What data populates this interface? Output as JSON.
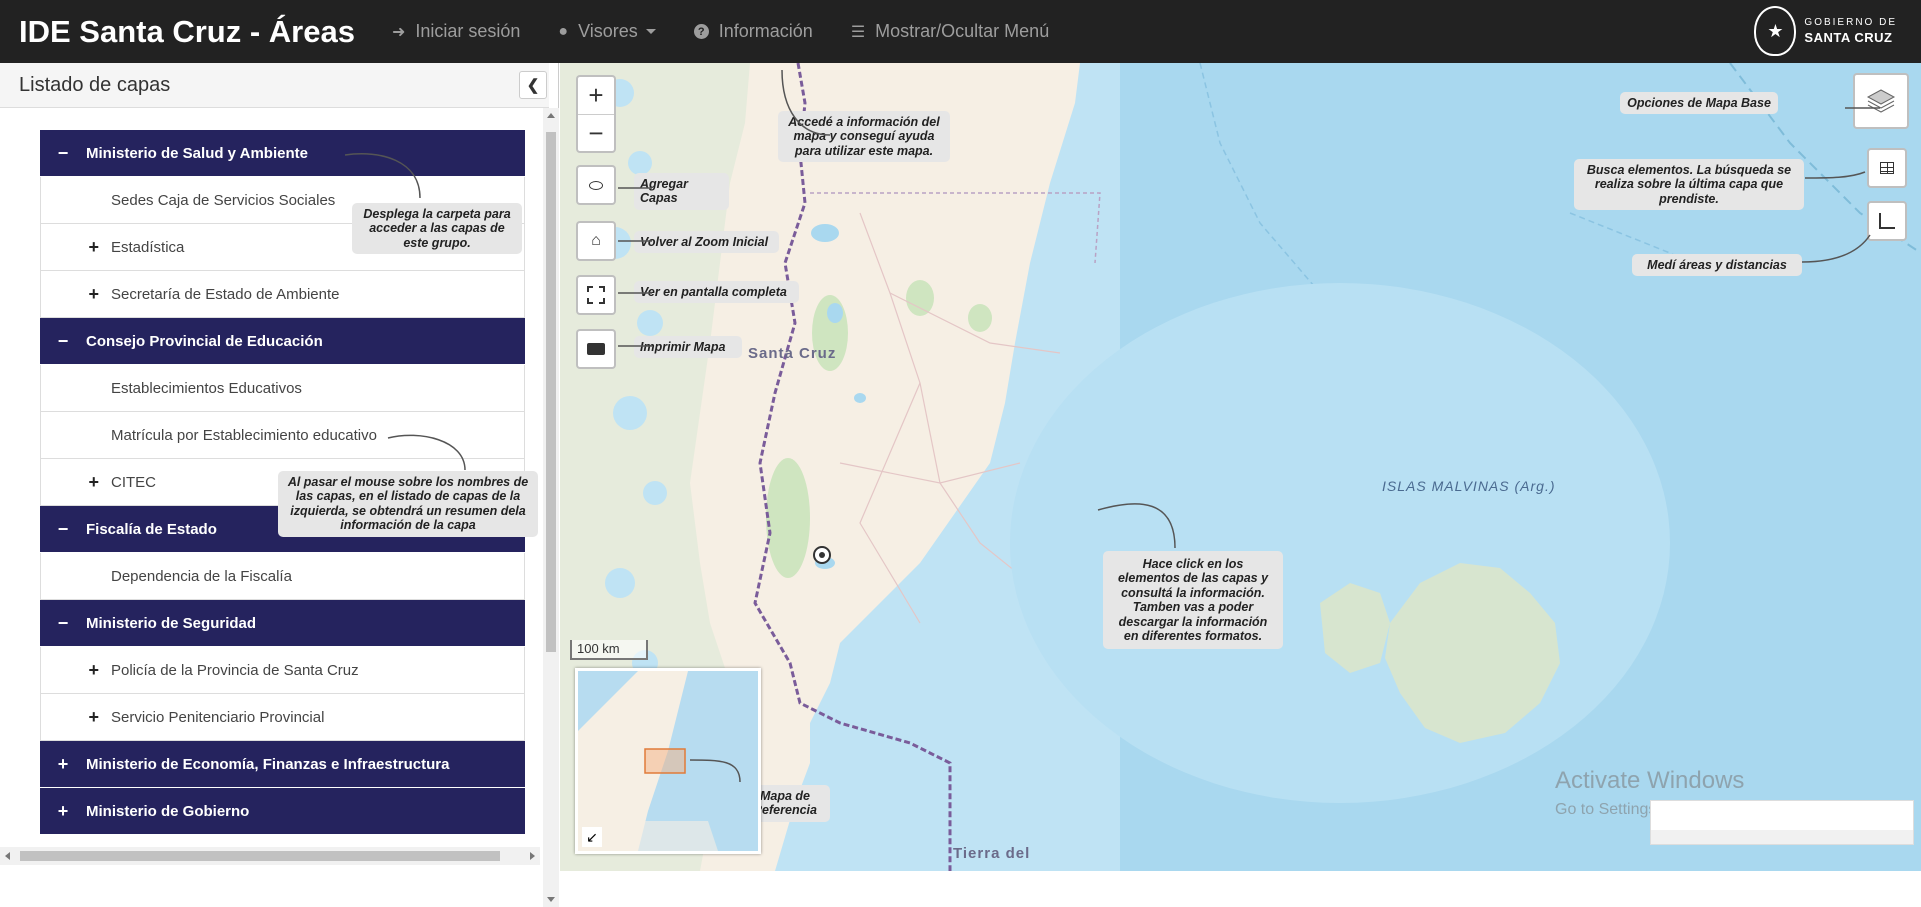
{
  "app": {
    "title": "IDE Santa Cruz - Áreas",
    "gov_logo_line1": "GOBIERNO DE",
    "gov_logo_line2": "SANTA CRUZ"
  },
  "nav": {
    "login": {
      "label": "Iniciar sesión",
      "icon": "sign-in-icon"
    },
    "viewers": {
      "label": "Visores",
      "icon": "globe-icon"
    },
    "info": {
      "label": "Información",
      "icon": "question-circle-icon"
    },
    "menu_toggle": {
      "label": "Mostrar/Ocultar Menú",
      "icon": "list-icon"
    }
  },
  "panel": {
    "title": "Listado de capas",
    "rows": [
      {
        "type": "group",
        "sign": "−",
        "label": "Ministerio de Salud y Ambiente"
      },
      {
        "type": "layer",
        "sign": "",
        "label": "Sedes Caja de Servicios Sociales"
      },
      {
        "type": "layer",
        "sign": "+",
        "label": "Estadística"
      },
      {
        "type": "layer",
        "sign": "+",
        "label": "Secretaría de Estado de Ambiente"
      },
      {
        "type": "group",
        "sign": "−",
        "label": "Consejo Provincial de Educación"
      },
      {
        "type": "layer",
        "sign": "",
        "label": "Establecimientos Educativos"
      },
      {
        "type": "layer",
        "sign": "",
        "label": "Matrícula por Establecimiento educativo"
      },
      {
        "type": "layer",
        "sign": "+",
        "label": "CITEC"
      },
      {
        "type": "group",
        "sign": "−",
        "label": "Fiscalía de Estado"
      },
      {
        "type": "layer",
        "sign": "",
        "label": "Dependencia de la Fiscalía"
      },
      {
        "type": "group",
        "sign": "−",
        "label": "Ministerio de Seguridad"
      },
      {
        "type": "layer",
        "sign": "+",
        "label": "Policía de la Provincia de Santa Cruz"
      },
      {
        "type": "layer",
        "sign": "+",
        "label": "Servicio Penitenciario Provincial"
      },
      {
        "type": "group",
        "sign": "+",
        "label": "Ministerio de Economía, Finanzas e Infraestructura"
      },
      {
        "type": "group",
        "sign": "+",
        "label": "Ministerio de Gobierno"
      }
    ]
  },
  "tips": {
    "folder": "Desplega la carpeta para acceder a las capas de este grupo.",
    "hover": "Al pasar el mouse sobre los nombres de las capas, en el listado de capas de la izquierda, se obtendrá un resumen dela información de la capa",
    "info": "Accedé a información del mapa y conseguí ayuda para utilizar este mapa.",
    "add_layers": "Agregar Capas",
    "zoom_initial": "Volver al Zoom Inicial",
    "fullscreen": "Ver en pantalla completa",
    "print": "Imprimir Mapa",
    "click_elements": "Hace click en los elementos de las capas y consultá la información. Tamben vas a poder descargar la información en diferentes formatos.",
    "reference_map": "Mapa de Referencia",
    "base_map": "Opciones de Mapa Base",
    "search": "Busca elementos. La búsqueda se realiza sobre la última capa que prendiste.",
    "measure": "Medí áreas y distancias"
  },
  "map": {
    "province_label": "Santa Cruz",
    "islands_label": "ISLAS MALVINAS (Arg.)",
    "tierra_label": "Tierra del",
    "scale_label": "100 km",
    "zoom_in": "+",
    "zoom_out": "−",
    "colors": {
      "sea": "#a9d8ef",
      "land": "#f6efe4",
      "andes": "#e6ebdc",
      "border": "#7a5c9a",
      "navbar": "#222222",
      "group_row": "#25235e"
    }
  },
  "watermark": {
    "line1": "Activate Windows",
    "line2": "Go to Settings to activate Windows."
  }
}
